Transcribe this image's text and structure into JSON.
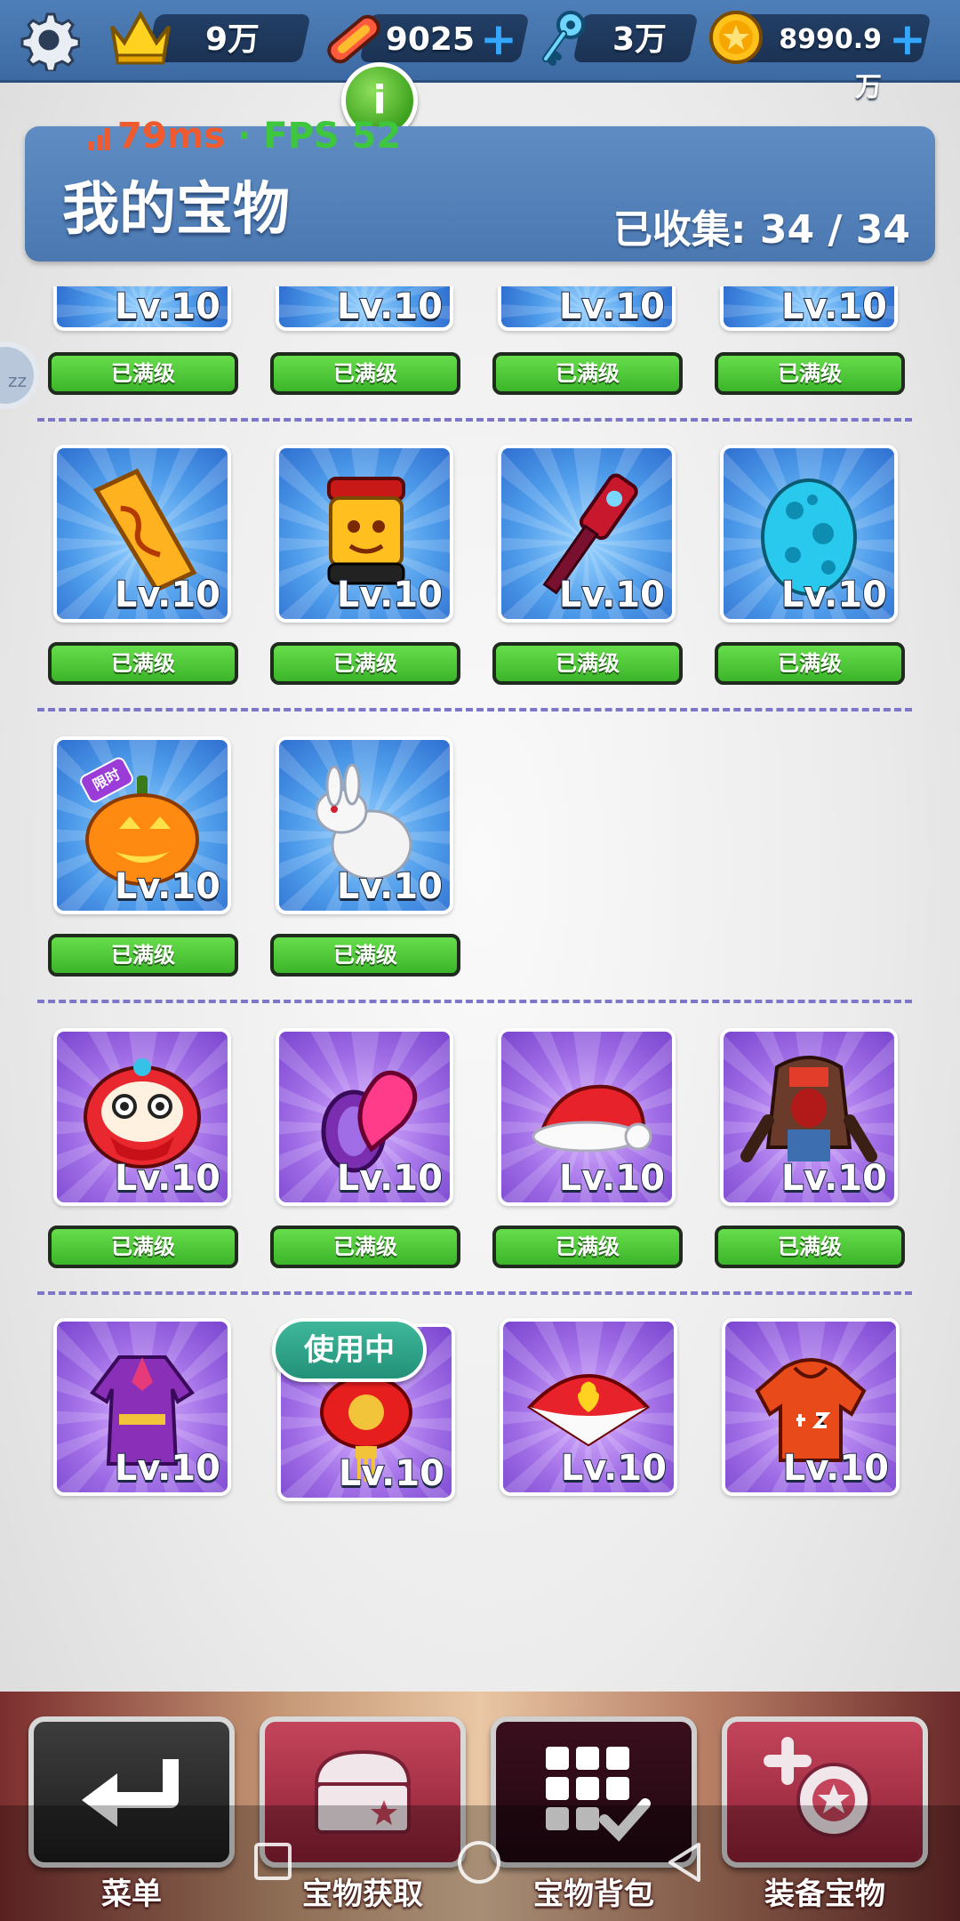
{
  "topbar": {
    "crowns": "9万",
    "tickets": "9025",
    "keys": "3万",
    "coins": "8990.9万",
    "plus_symbol": "+",
    "info_symbol": "i"
  },
  "overlay": {
    "ping": "79ms",
    "separator": " · ",
    "fps": "FPS 52"
  },
  "side_handle": "zz",
  "header": {
    "title": "我的宝物",
    "collected_label": "已收集:",
    "collected_value": "34 / 34"
  },
  "item_level": "Lv.10",
  "max_label": "已满级",
  "in_use_label": "使用中",
  "limited_label": "限时",
  "items": {
    "row1": [
      "item",
      "item",
      "item",
      "item"
    ],
    "row2": [
      "golden-scroll",
      "golden-lion-drum",
      "magic-guitar",
      "cyan-egg"
    ],
    "row3": [
      "pumpkin",
      "white-rabbit"
    ],
    "row4": [
      "lion-dance-head",
      "heart-ring",
      "santa-hat",
      "hooded-monster"
    ],
    "row5": [
      "purple-robe",
      "red-lantern",
      "heart-fan",
      "red-hoodie"
    ]
  },
  "colors": {
    "blue_card": "#4d9bea",
    "purple_card": "#a06de6",
    "green_button": "#3cb52a"
  },
  "nav": [
    {
      "label": "菜单",
      "icon": "return-icon"
    },
    {
      "label": "宝物获取",
      "icon": "chest-icon"
    },
    {
      "label": "宝物背包",
      "icon": "grid-check-icon"
    },
    {
      "label": "装备宝物",
      "icon": "equip-icon"
    }
  ]
}
